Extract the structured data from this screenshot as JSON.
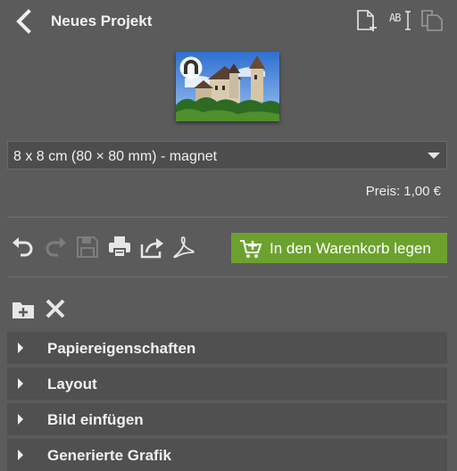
{
  "header": {
    "title": "Neues Projekt",
    "back_icon": "chevron-left-icon",
    "action_icons": [
      "new-page-icon",
      "text-frame-icon",
      "duplicate-page-icon"
    ],
    "text_frame_label": "AB"
  },
  "preview": {
    "image_desc": "castle-photo",
    "badge_icon": "magnet-icon"
  },
  "product_select": {
    "value": "8 x 8 cm (80 × 80 mm) - magnet"
  },
  "price": {
    "text": "Preis: 1,00 €"
  },
  "toolbar": {
    "icons": [
      "undo-icon",
      "redo-icon",
      "save-icon",
      "print-icon",
      "share-icon",
      "pdf-icon"
    ],
    "cart_label": "In den Warenkorb legen",
    "cart_color": "#6da12e"
  },
  "file_tools": {
    "icons": [
      "add-folder-icon",
      "close-icon"
    ]
  },
  "sections": [
    {
      "label": "Papiereigenschaften"
    },
    {
      "label": "Layout"
    },
    {
      "label": "Bild einfügen"
    },
    {
      "label": "Generierte Grafik"
    }
  ],
  "colors": {
    "background": "#5b5b5b",
    "panel": "#505050",
    "accent": "#6da12e"
  }
}
